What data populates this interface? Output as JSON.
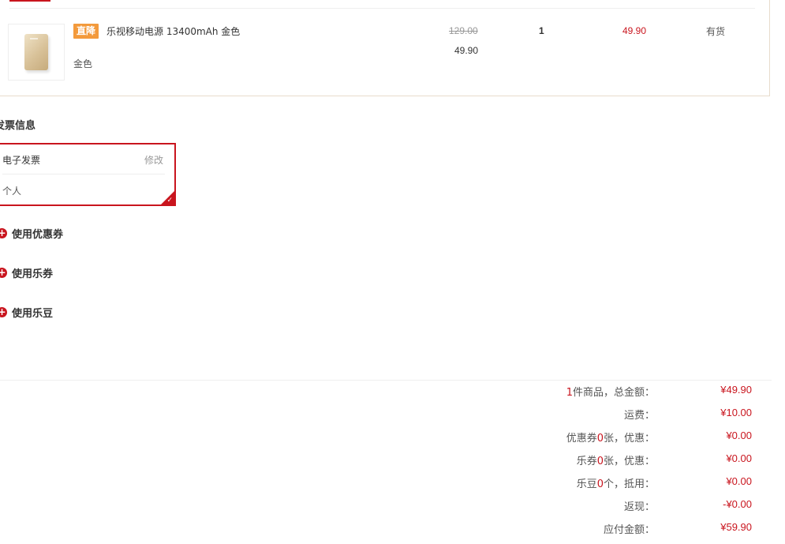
{
  "goods": {
    "promo_badge": "直降",
    "name": "乐视移动电源 13400mAh 金色",
    "color": "金色",
    "price_original": "129.00",
    "price_current": "49.90",
    "quantity": "1",
    "subtotal": "49.90",
    "stock": "有货"
  },
  "invoice": {
    "section_title": "发票信息",
    "type": "电子发票",
    "edit_label": "修改",
    "holder": "个人",
    "check_mark": "✓"
  },
  "discounts": {
    "coupon_label": "使用优惠券",
    "le_coupon_label": "使用乐券",
    "le_bean_label": "使用乐豆",
    "plus_glyph": "+"
  },
  "summary": {
    "rows": [
      {
        "prefix": "",
        "highlight": "1",
        "suffix": "件商品，总金额：",
        "value": "¥49.90"
      },
      {
        "prefix": "运费：",
        "highlight": "",
        "suffix": "",
        "value": "¥10.00"
      },
      {
        "prefix": "优惠券",
        "highlight": "0",
        "suffix": "张，优惠：",
        "value": "¥0.00"
      },
      {
        "prefix": "乐券",
        "highlight": "0",
        "suffix": "张，优惠：",
        "value": "¥0.00"
      },
      {
        "prefix": "乐豆",
        "highlight": "0",
        "suffix": "个，抵用：",
        "value": "¥0.00"
      },
      {
        "prefix": "返现：",
        "highlight": "",
        "suffix": "",
        "value": "-¥0.00"
      },
      {
        "prefix": "应付金额：",
        "highlight": "",
        "suffix": "",
        "value": "¥59.90"
      }
    ]
  },
  "colors": {
    "accent_red": "#c9151e",
    "promo_orange": "#f39a3c",
    "border_beige": "#e8dccc"
  }
}
